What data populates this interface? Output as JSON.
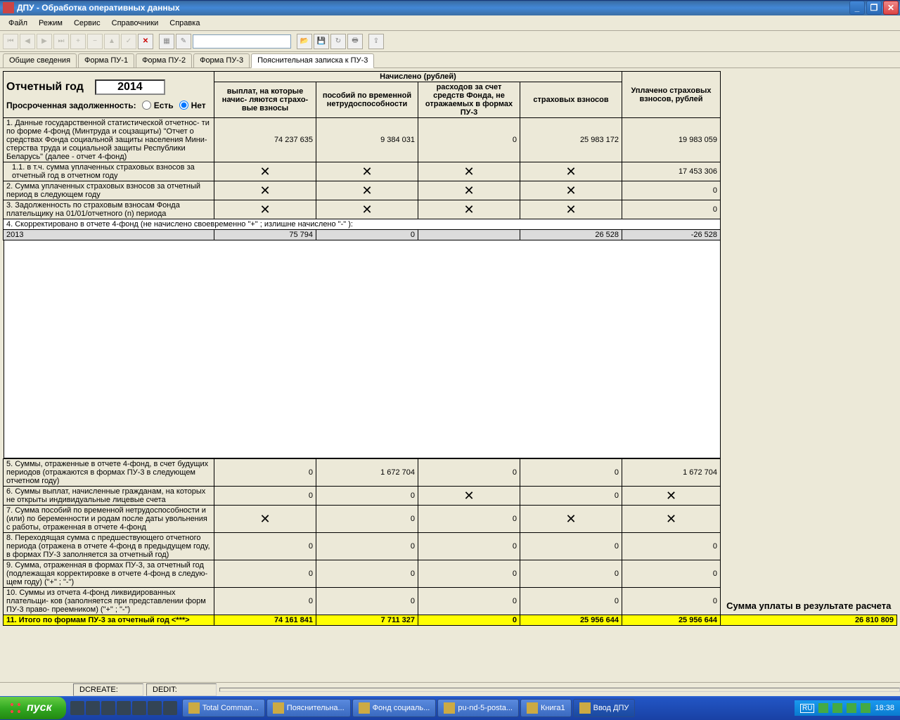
{
  "window": {
    "title": "ДПУ - Обработка оперативных данных"
  },
  "menu": {
    "file": "Файл",
    "mode": "Режим",
    "service": "Сервис",
    "ref": "Справочники",
    "help": "Справка"
  },
  "tabs": {
    "t1": "Общие сведения",
    "t2": "Форма ПУ-1",
    "t3": "Форма ПУ-2",
    "t4": "Форма ПУ-3",
    "t5": "Пояснительная записка к ПУ-3"
  },
  "panel": {
    "year_label": "Отчетный год",
    "year": "2014",
    "delinq_label": "Просроченная задолженность:",
    "yes": "Есть",
    "no": "Нет"
  },
  "headers": {
    "accrued": "Начислено (рублей)",
    "paid": "Уплачено страховых взносов, рублей",
    "c1": "выплат, на которые начис- ляются страхо- вые взносы",
    "c2": "пособий по временной нетрудоспособности",
    "c3": "расходов за счет средств Фонда, не отражаемых в формах ПУ-3",
    "c4": "страховых взносов"
  },
  "rows": {
    "r1": "1. Данные государственной статистической отчетнос- ти по форме 4-фонд (Минтруда и соцзащиты) \"Отчет о средствах Фонда социальной защиты населения Мини- стерства труда и социальной защиты Республики Беларусь\" (далее - отчет 4-фонд)",
    "r1_1": "1.1. в т.ч. сумма уплаченных страховых взносов за отчетный год в отчетном году",
    "r2": "2. Сумма уплаченных страховых взносов за отчетный период в следующем году",
    "r3": "3. Задолженность по страховым взносам Фонда плательщику на 01/01/отчетного (n) периода",
    "r4": "4. Скорректировано в отчете 4-фонд  (не начислено своевременно \"+\" ; излишне начислено \"-\" ):",
    "r4y": "2013",
    "r5": "5. Суммы, отраженные в отчете 4-фонд, в счет будущих периодов (отражаются в формах ПУ-3 в следующем отчетном году)",
    "r6": "6. Суммы выплат, начисленные гражданам, на которых не открыты индивидуальные лицевые счета",
    "r7": "7. Сумма пособий по временной нетрудоспособности и (или) по беременности и родам после даты увольнения с работы, отраженная в отчете  4-фонд",
    "r8": "8. Переходящая сумма с предшествующего отчетного периода (отражена в отчете 4-фонд в предыдущем году, в формах ПУ-3 заполняется за отчетный год)",
    "r9": "9. Сумма, отраженная в формах ПУ-3, за отчетный год (подлежащая корректировке в отчете 4-фонд в следую- щем году) (\"+\" ; \"-\")",
    "r10": "10. Суммы из отчета 4-фонд  ликвидированных плательщи- ков (заполняется при представлении форм ПУ-3 право- преемником) (\"+\" ; \"-\")",
    "r11": "11. Итого по формам ПУ-3 за отчетный год <***>"
  },
  "data": {
    "r1": {
      "c1": "74 237 635",
      "c2": "9 384 031",
      "c3": "0",
      "c4": "25 983 172",
      "c5": "19 983 059"
    },
    "r1_1": {
      "c5": "17 453 306"
    },
    "r2": {
      "c5": "0"
    },
    "r3": {
      "c5": "0"
    },
    "r4y": {
      "c1": "75 794",
      "c2": "0",
      "c3": "",
      "c4": "26 528",
      "c5": "-26 528"
    },
    "r5": {
      "c1": "0",
      "c2": "1 672 704",
      "c3": "0",
      "c4": "0",
      "c5": "1 672 704"
    },
    "r6": {
      "c1": "0",
      "c2": "0",
      "c4": "0"
    },
    "r7": {
      "c2": "0",
      "c3": "0"
    },
    "r8": {
      "c1": "0",
      "c2": "0",
      "c3": "0",
      "c4": "0",
      "c5": "0"
    },
    "r9": {
      "c1": "0",
      "c2": "0",
      "c3": "0",
      "c4": "0",
      "c5": "0"
    },
    "r10": {
      "c1": "0",
      "c2": "0",
      "c3": "0",
      "c4": "0",
      "c5": "0"
    },
    "r11": {
      "c1": "74 161 841",
      "c2": "7 711 327",
      "c3": "0",
      "c4": "25 956 644",
      "c5": "25 956 644"
    }
  },
  "summary": {
    "label": "Сумма уплаты в результате расчета",
    "value": "26 810 809"
  },
  "statusbar": {
    "dcreate": "DCREATE:",
    "dedit": "DEDIT:"
  },
  "taskbar": {
    "start": "пуск",
    "items": [
      "Total Comman...",
      "Пояснительна...",
      "Фонд социаль...",
      "pu-nd-5-posta...",
      "Книга1",
      "Ввод ДПУ"
    ],
    "lang": "RU",
    "time": "18:38"
  }
}
